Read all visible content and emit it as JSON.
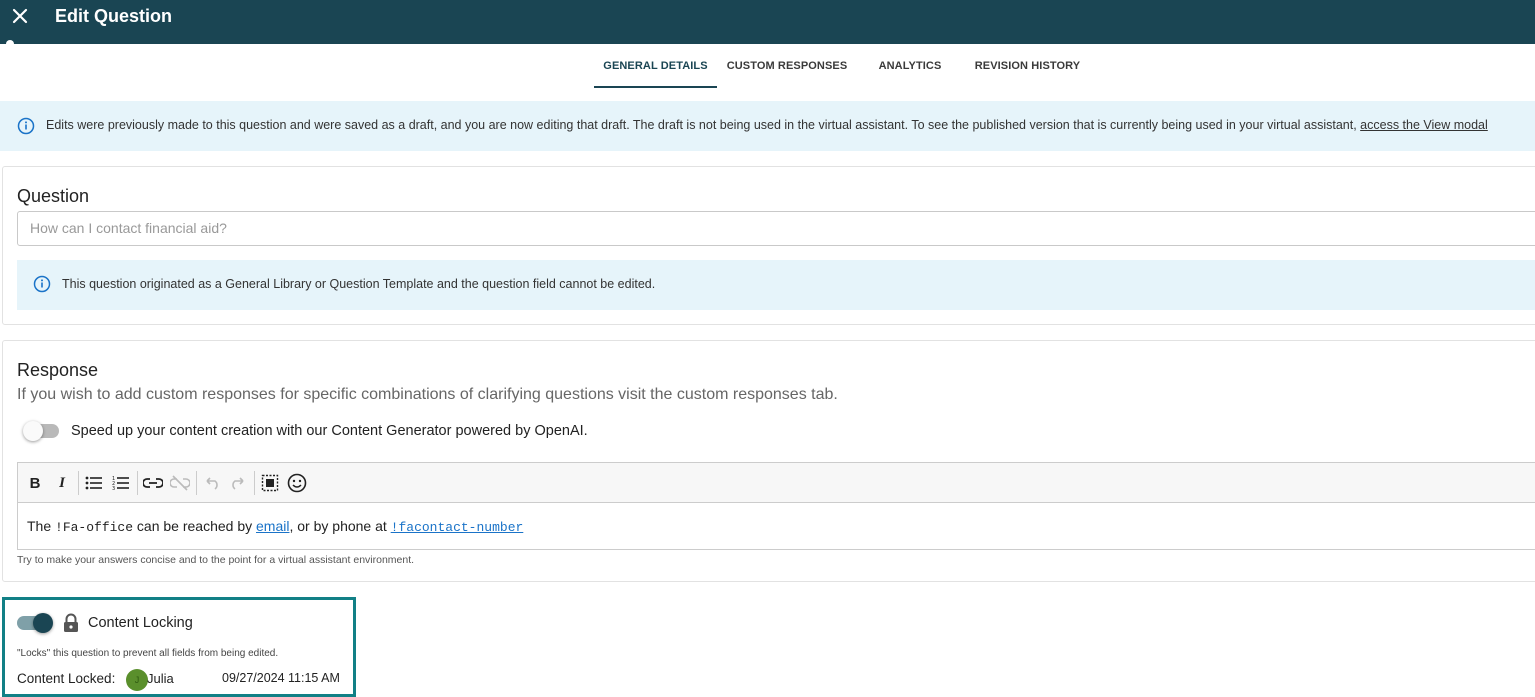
{
  "header": {
    "title": "Edit Question",
    "close_icon": "close-icon"
  },
  "tabs": [
    {
      "label": "GENERAL DETAILS",
      "active": true
    },
    {
      "label": "CUSTOM RESPONSES",
      "active": false
    },
    {
      "label": "ANALYTICS",
      "active": false
    },
    {
      "label": "REVISION HISTORY",
      "active": false
    }
  ],
  "draft_banner": {
    "text": "Edits were previously made to this question and were saved as a draft, and you are now editing that draft. The draft is not being used in the virtual assistant. To see the published version that is currently being used in your virtual assistant, ",
    "link": "access the View modal"
  },
  "question": {
    "heading": "Question",
    "placeholder": "How can I contact financial aid?",
    "info": "This question originated as a General Library or Question Template and the question field cannot be edited."
  },
  "response": {
    "heading": "Response",
    "subtitle": "If you wish to add custom responses for specific combinations of clarifying questions visit the custom responses tab.",
    "generator_toggle_label": "Speed up your content creation with our Content Generator powered by OpenAI.",
    "generator_enabled": false,
    "toolbar": [
      "bold",
      "italic",
      "bulleted-list",
      "numbered-list",
      "insert-link",
      "remove-link",
      "undo",
      "redo",
      "select-all",
      "emoji"
    ],
    "content": {
      "t1": "The ",
      "code1": "!Fa-office",
      "t2": " can be reached by ",
      "link1": "email",
      "t3": ", or by phone at ",
      "link2": "!facontact-number"
    },
    "hint": "Try to make your answers concise and to the point for a virtual assistant environment."
  },
  "content_locking": {
    "label": "Content Locking",
    "enabled": true,
    "description": "\"Locks\" this question to prevent all fields from being edited.",
    "locked_label": "Content Locked:",
    "avatar_initials": "J",
    "user": "Julia",
    "date": "09/27/2024 11:15 AM"
  },
  "colors": {
    "header": "#1a4553",
    "info_bg": "#e6f4fa",
    "highlight_border": "#128086",
    "link": "#1a73c8"
  }
}
